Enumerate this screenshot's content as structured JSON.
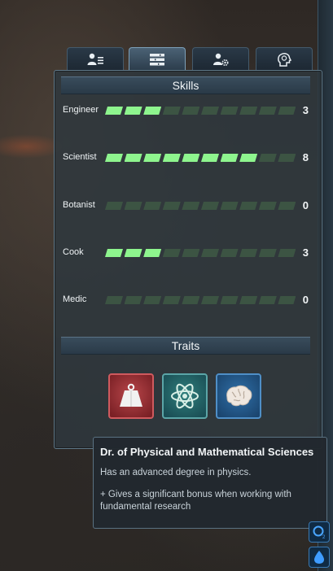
{
  "tabs": [
    {
      "icon": "person-list-icon",
      "active": false
    },
    {
      "icon": "skills-list-icon",
      "active": true
    },
    {
      "icon": "person-gear-icon",
      "active": false
    },
    {
      "icon": "head-brain-icon",
      "active": false
    }
  ],
  "skills_header": "Skills",
  "skills": [
    {
      "name": "Engineer",
      "value": "3"
    },
    {
      "name": "Scientist",
      "value": "8"
    },
    {
      "name": "Botanist",
      "value": "0"
    },
    {
      "name": "Cook",
      "value": "3"
    },
    {
      "name": "Medic",
      "value": "0"
    }
  ],
  "skill_max": 10,
  "colors": {
    "bar_on": "#8ef58e",
    "bar_off": "#3c5443"
  },
  "traits_header": "Traits",
  "traits": [
    {
      "icon": "weight-icon",
      "color": "#b8464a"
    },
    {
      "icon": "atom-icon",
      "color": "#2f7f7c"
    },
    {
      "icon": "brain-icon",
      "color": "#2f6fa8"
    }
  ],
  "tooltip": {
    "title": "Dr. of Physical and Mathematical Sciences",
    "description": "Has an advanced degree in physics.",
    "bonus": "+ Gives a significant bonus when working with fundamental research"
  },
  "side_buttons": [
    {
      "icon": "oxygen-icon"
    },
    {
      "icon": "water-drop-icon"
    }
  ]
}
